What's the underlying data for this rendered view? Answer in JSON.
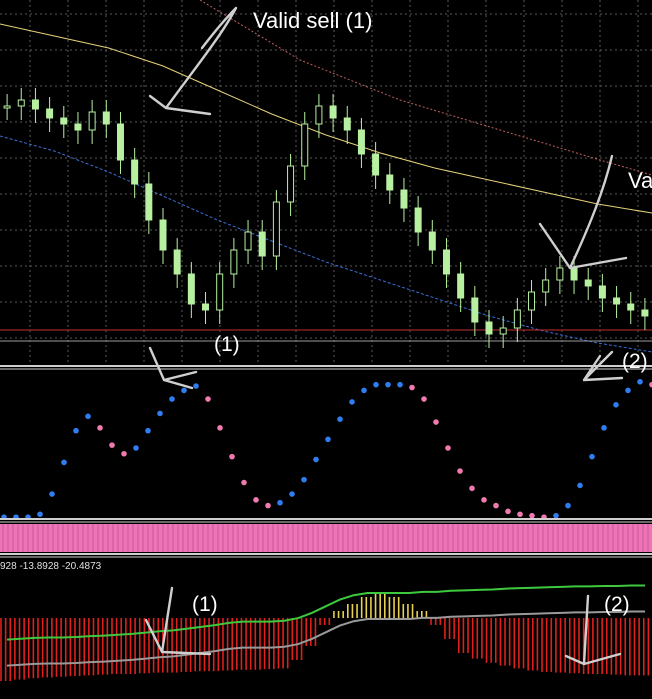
{
  "annotations": {
    "valid_sell_1": "Valid sell (1)",
    "valid_sell_2_partial": "Va",
    "osc_mark_1": "(1)",
    "osc_mark_2": "(2)",
    "hist_mark_1": "(1)",
    "hist_mark_2": "(2)"
  },
  "indicator_readout": "928 -13.8928 -20.4873",
  "colors": {
    "background": "#000000",
    "grid": "#5a5a5a",
    "candle_bull": "#b7f0a0",
    "candle_bear": "#b7f0a0",
    "ma_slow": "#e6d27a",
    "ma_fast": "#3a6fd8",
    "ma_red": "#c06060",
    "hline_red": "#c03030",
    "dot_blue": "#2f7df0",
    "dot_pink": "#f07ab0",
    "pink_band": "#ee74b5",
    "hist_red": "#e0201c",
    "hist_yellow": "#e8d050",
    "signal_green": "#3ec83e",
    "signal_gray": "#9a9a9a",
    "arrow": "#cfcfcf"
  },
  "chart_data": [
    {
      "type": "candlestick",
      "panel": "price",
      "series": [
        {
          "name": "",
          "kind": "moving-average",
          "values": [
            0.92,
            0.88,
            0.84,
            0.78,
            0.7,
            0.62,
            0.55,
            0.49,
            0.44,
            0.4,
            0.36,
            0.32,
            0.29
          ]
        },
        {
          "name": "",
          "kind": "moving-average",
          "values": [
            0.78,
            0.73,
            0.66,
            0.58,
            0.5,
            0.43,
            0.36,
            0.3,
            0.24,
            0.18,
            0.13,
            0.09,
            0.06
          ]
        }
      ],
      "closes": [
        0.78,
        0.8,
        0.77,
        0.74,
        0.72,
        0.7,
        0.76,
        0.72,
        0.6,
        0.52,
        0.4,
        0.3,
        0.22,
        0.12,
        0.1,
        0.22,
        0.3,
        0.36,
        0.28,
        0.46,
        0.58,
        0.72,
        0.78,
        0.74,
        0.7,
        0.62,
        0.55,
        0.5,
        0.44,
        0.36,
        0.3,
        0.22,
        0.14,
        0.06,
        0.02,
        0.04,
        0.1,
        0.16,
        0.2,
        0.24,
        0.2,
        0.18,
        0.14,
        0.12,
        0.1,
        0.08
      ]
    },
    {
      "type": "scatter",
      "panel": "oscillator",
      "series": [
        {
          "name": "",
          "x": [
            0,
            4,
            8,
            12,
            16,
            20,
            24,
            28,
            32,
            36,
            40,
            44,
            48,
            52,
            56,
            60,
            64,
            68,
            72,
            76,
            80,
            84,
            88,
            92,
            96,
            100,
            104,
            108,
            112,
            116,
            120,
            124,
            128,
            132,
            136,
            140,
            144,
            148,
            152,
            156,
            160,
            164,
            168,
            172,
            176,
            180,
            184,
            188,
            192,
            196,
            200,
            204,
            208,
            212,
            216
          ],
          "y": [
            0.02,
            0.02,
            0.02,
            0.04,
            0.18,
            0.4,
            0.62,
            0.72,
            0.64,
            0.52,
            0.46,
            0.5,
            0.62,
            0.74,
            0.84,
            0.9,
            0.93,
            0.84,
            0.64,
            0.44,
            0.26,
            0.14,
            0.1,
            0.12,
            0.18,
            0.28,
            0.42,
            0.56,
            0.7,
            0.82,
            0.9,
            0.94,
            0.94,
            0.94,
            0.92,
            0.84,
            0.68,
            0.5,
            0.34,
            0.22,
            0.14,
            0.1,
            0.06,
            0.04,
            0.03,
            0.02,
            0.03,
            0.1,
            0.24,
            0.44,
            0.64,
            0.8,
            0.9,
            0.96,
            0.94
          ]
        }
      ]
    },
    {
      "type": "bar",
      "panel": "histogram",
      "series": [
        {
          "name": "",
          "kind": "histogram",
          "values": [
            0.9,
            0.88,
            0.86,
            0.85,
            0.84,
            0.83,
            0.82,
            0.81,
            0.8,
            0.8,
            0.79,
            0.78,
            0.78,
            0.77,
            0.76,
            0.76,
            0.75,
            0.74,
            0.74,
            0.73,
            0.72,
            0.6,
            0.4,
            0.1,
            -0.1,
            -0.2,
            -0.3,
            -0.35,
            -0.3,
            -0.2,
            -0.1,
            0.1,
            0.3,
            0.5,
            0.58,
            0.64,
            0.68,
            0.72,
            0.75,
            0.77,
            0.78,
            0.79,
            0.8,
            0.8,
            0.81,
            0.82,
            0.82
          ]
        },
        {
          "name": "",
          "kind": "signal",
          "values": [
            0.62,
            0.58,
            0.54,
            0.52,
            0.52,
            0.5,
            0.46,
            0.44,
            0.4,
            0.36,
            0.3,
            0.24,
            0.2,
            0.12,
            0.04,
            -0.04,
            -0.14,
            -0.2,
            -0.2,
            -0.2,
            -0.24,
            -0.36,
            -0.6,
            -0.9,
            -1.2,
            -1.4,
            -1.5,
            -1.5,
            -1.5,
            -1.5,
            -1.55,
            -1.55,
            -1.6,
            -1.62,
            -1.64,
            -1.66,
            -1.7,
            -1.72,
            -1.74,
            -1.76,
            -1.78,
            -1.8,
            -1.8,
            -1.82,
            -1.82,
            -1.84,
            -1.84
          ]
        }
      ]
    }
  ]
}
